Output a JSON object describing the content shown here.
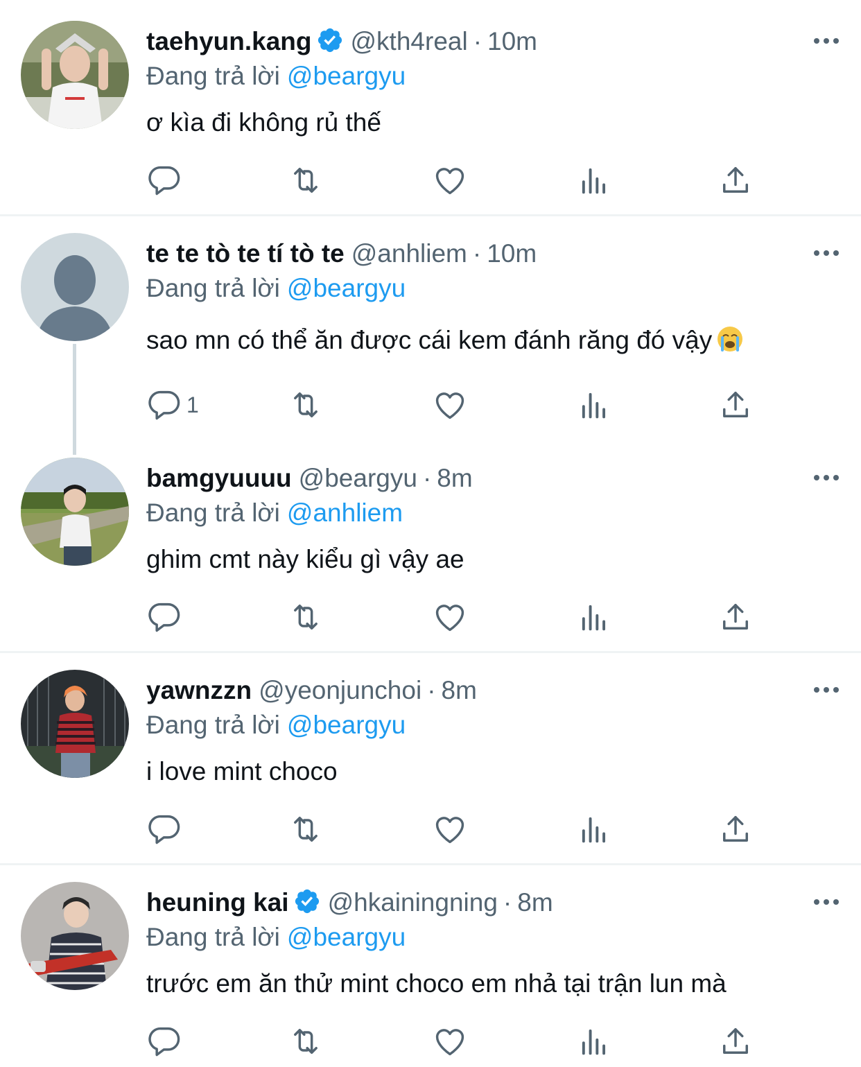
{
  "reply_prefix": "Đang trả lời",
  "tweets": [
    {
      "display_name": "taehyun.kang",
      "verified": true,
      "handle": "@kth4real",
      "time": "10m",
      "reply_to": "@beargyu",
      "text": "ơ kìa đi không rủ thế",
      "reply_count": ""
    },
    {
      "display_name": "te te tò te tí tò te",
      "verified": false,
      "handle": "@anhliem",
      "time": "10m",
      "reply_to": "@beargyu",
      "text": "sao mn có thể ăn được cái kem đánh răng đó vậy",
      "reply_count": "1"
    },
    {
      "display_name": "bamgyuuuu",
      "verified": false,
      "handle": "@beargyu",
      "time": "8m",
      "reply_to": "@anhliem",
      "text": "ghim cmt này kiểu gì vậy ae",
      "reply_count": ""
    },
    {
      "display_name": "yawnzzn",
      "verified": false,
      "handle": "@yeonjunchoi",
      "time": "8m",
      "reply_to": "@beargyu",
      "text": "i love mint choco",
      "reply_count": ""
    },
    {
      "display_name": "heuning kai",
      "verified": true,
      "handle": "@hkainingning",
      "time": "8m",
      "reply_to": "@beargyu",
      "text": "trước em ăn thử mint choco em nhả tại trận lun mà",
      "reply_count": ""
    }
  ],
  "icons": {
    "reply": "reply-icon",
    "retweet": "retweet-icon",
    "like": "heart-icon",
    "views": "analytics-icon",
    "share": "share-icon",
    "more": "more-icon",
    "verified": "verified-badge-icon",
    "emoji": "loudly-crying-face-emoji"
  },
  "colors": {
    "accent": "#1d9bf0",
    "secondary_text": "#536471",
    "divider": "#eff3f4"
  }
}
